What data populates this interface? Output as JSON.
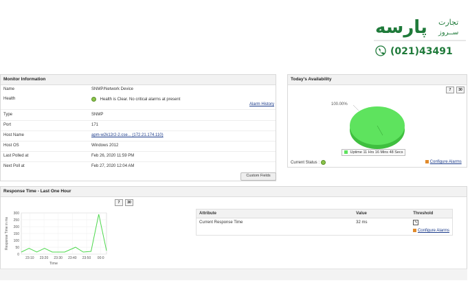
{
  "brand": {
    "logo_text": "پارسه",
    "logo_sub_1": "تجارت",
    "logo_sub_2": "ســروز",
    "phone": "(021)43491",
    "color": "#1f7a3a"
  },
  "monitor": {
    "title": "Monitor Information",
    "rows": [
      {
        "label": "Name",
        "value": "SNMP/Network Device"
      },
      {
        "label": "Health",
        "value": "Health is Clear. No critical alarms at present"
      },
      {
        "label": "Type",
        "value": "SNMP"
      },
      {
        "label": "Port",
        "value": "171"
      },
      {
        "label": "Host Name",
        "value": "apm-w2k12r2-2.cse... (172.21.174.110)"
      },
      {
        "label": "Host OS",
        "value": "Windows 2012"
      },
      {
        "label": "Last Polled at",
        "value": "Feb 26, 2020 11:59 PM"
      },
      {
        "label": "Next Poll at",
        "value": "Feb 27, 2020 12:04 AM"
      }
    ],
    "alarm_history": "Alarm History",
    "custom_fields": "Custom Fields"
  },
  "availability": {
    "title": "Today's Availability",
    "btn_7": "7",
    "btn_30": "30",
    "pie_label": "100.00%",
    "legend": "Uptime 11 Hrs 16 Mins 48 Secs",
    "current_status": "Current Status :",
    "configure_alarms": "Configure Alarms",
    "colors": {
      "up": "#5ee35e",
      "up_dark": "#3fbf3f"
    }
  },
  "response": {
    "title": "Response Time - Last One Hour",
    "btn_7": "7",
    "btn_30": "30",
    "table": {
      "headers": [
        "Attribute",
        "Value",
        "Threshold"
      ],
      "rows": [
        {
          "attribute": "Current Response Time",
          "value": "32 ms"
        }
      ]
    },
    "configure_alarms": "Configure Alarms"
  },
  "chart_data": {
    "type": "line",
    "ylabel": "Response Time in ms",
    "xlabel": "Time",
    "ylim": [
      0,
      300
    ],
    "yticks": [
      0,
      50,
      100,
      150,
      200,
      250,
      300
    ],
    "xticks": [
      "23:10",
      "23:20",
      "23:30",
      "23:40",
      "23:50",
      "00:0"
    ],
    "series": [
      {
        "color": "#4cd84c",
        "points": [
          {
            "t": 0,
            "v": 15
          },
          {
            "t": 5,
            "v": 42
          },
          {
            "t": 10,
            "v": 15
          },
          {
            "t": 15,
            "v": 42
          },
          {
            "t": 20,
            "v": 15
          },
          {
            "t": 28,
            "v": 15
          },
          {
            "t": 35,
            "v": 50
          },
          {
            "t": 40,
            "v": 15
          },
          {
            "t": 45,
            "v": 20
          },
          {
            "t": 50,
            "v": 290
          },
          {
            "t": 55,
            "v": 25
          }
        ]
      }
    ],
    "grid": true
  }
}
